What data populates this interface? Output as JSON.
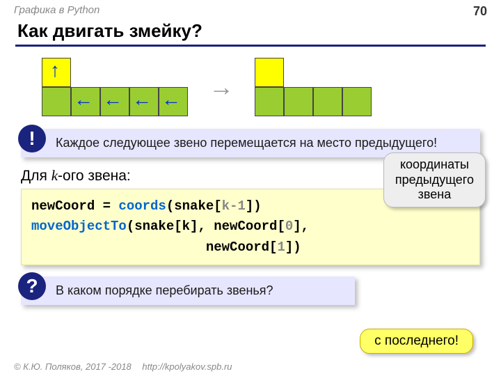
{
  "header": {
    "topic": "Графика в Python",
    "page": "70"
  },
  "title": "Как двигать змейку?",
  "callout1": {
    "badge": "!",
    "text": "Каждое следующее звено перемещается на место предыдущего!"
  },
  "para_pre": "Для ",
  "para_k": "k",
  "para_post": "-ого звена:",
  "code": {
    "l1a": "newCoord = ",
    "l1b": "coords",
    "l1c": "(snake[",
    "l1d": "k-1",
    "l1e": "])",
    "l2a": "moveObjectTo",
    "l2b": "(snake[k], newCoord[",
    "l2c": "0",
    "l2d": "],",
    "l3a": "                      newCoord[",
    "l3b": "1",
    "l3c": "])"
  },
  "note": {
    "l1": "координаты",
    "l2": "предыдущего",
    "l3": "звена"
  },
  "callout2": {
    "badge": "?",
    "text": "В каком порядке перебирать звенья?"
  },
  "answer": "с последнего!",
  "footer": {
    "copy": "© К.Ю. Поляков, 2017 -2018",
    "url": "http://kpolyakov.spb.ru"
  }
}
